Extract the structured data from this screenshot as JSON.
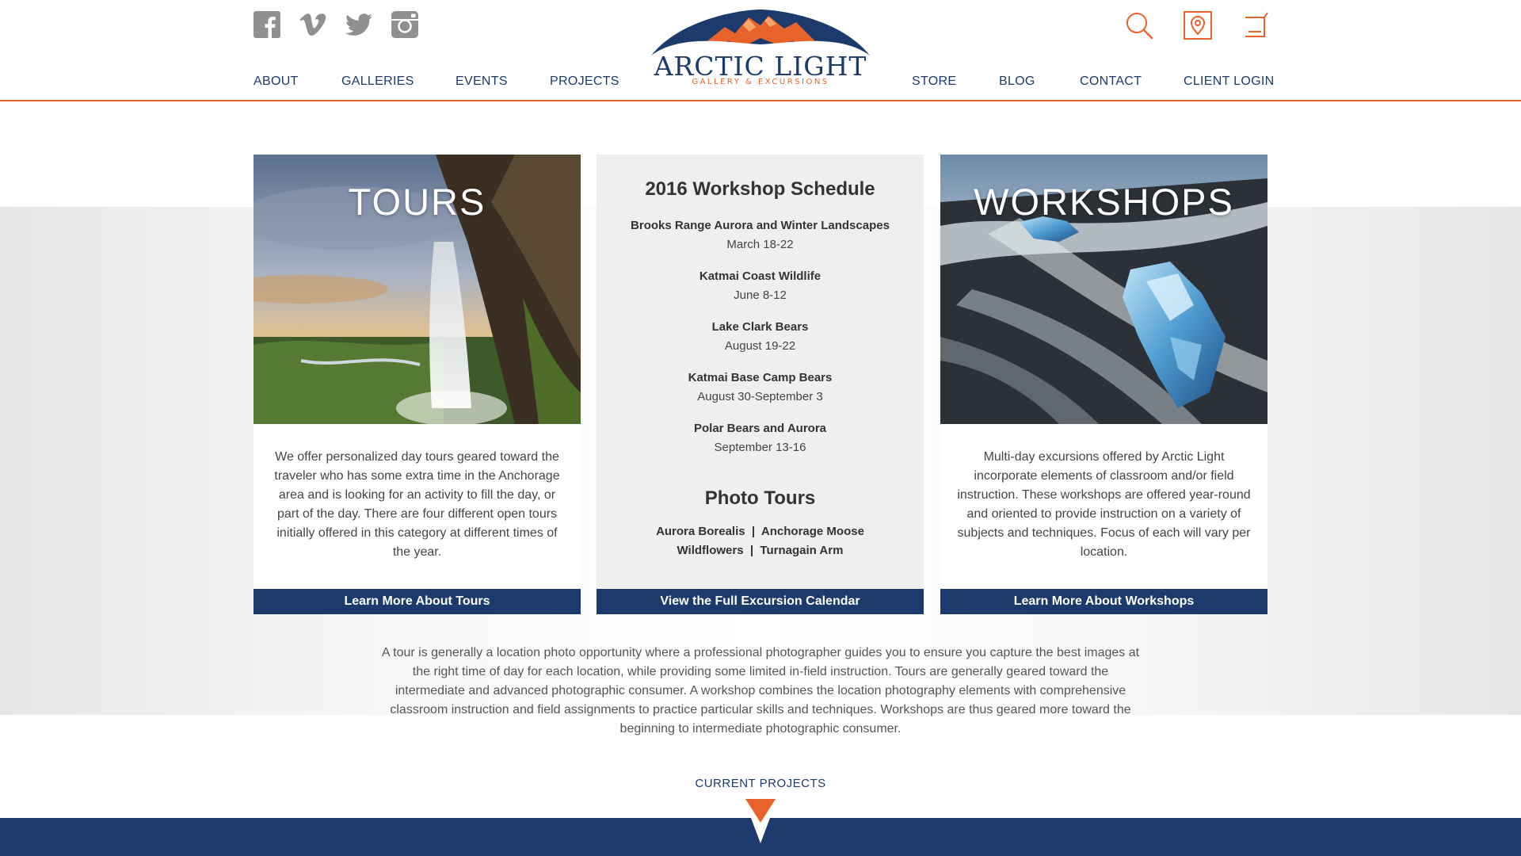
{
  "social": {
    "icons": [
      "facebook-icon",
      "vimeo-icon",
      "twitter-icon",
      "instagram-icon"
    ]
  },
  "tools": {
    "icons": [
      "search-icon",
      "map-pin-icon",
      "cart-icon"
    ]
  },
  "logo": {
    "title": "ARCTIC LIGHT",
    "subtitle": "GALLERY & EXCURSIONS"
  },
  "nav": {
    "left": [
      "ABOUT",
      "GALLERIES",
      "EVENTS",
      "PROJECTS"
    ],
    "right": [
      "STORE",
      "BLOG",
      "CONTACT",
      "CLIENT LOGIN"
    ]
  },
  "tours": {
    "title": "TOURS",
    "description": "We offer personalized day tours geared toward the traveler who has some extra time in the Anchorage area and is looking for an activity to fill the day, or part of the day. There are four different open tours initially offered in this category at different times of the year.",
    "button": "Learn More About Tours"
  },
  "schedule": {
    "title": "2016 Workshop Schedule",
    "items": [
      {
        "name": "Brooks Range Aurora and Winter Landscapes",
        "date": "March 18-22"
      },
      {
        "name": "Katmai Coast Wildlife",
        "date": "June 8-12"
      },
      {
        "name": "Lake Clark Bears",
        "date": "August 19-22"
      },
      {
        "name": "Katmai Base Camp Bears",
        "date": "August 30-September 3"
      },
      {
        "name": "Polar Bears and Aurora",
        "date": "September 13-16"
      }
    ],
    "photo_tours_title": "Photo Tours",
    "photo_tours_line1": "Aurora Borealis  |  Anchorage Moose",
    "photo_tours_line2": "Wildflowers  |  Turnagain Arm",
    "button": "View the Full Excursion Calendar"
  },
  "workshops": {
    "title": "WORKSHOPS",
    "description": "Multi-day excursions offered by Arctic Light incorporate elements of classroom and/or field instruction. These workshops are offered year-round and oriented to provide instruction on a variety of subjects and techniques. Focus of each will vary per location.",
    "button": "Learn More About Workshops"
  },
  "explainer": "A tour is generally a location photo opportunity where a professional photographer guides you to ensure you capture the best images at the right time of day for each location, while providing some limited in-field instruction. Tours are generally geared toward the intermediate and advanced photographic consumer. A workshop combines the location photography elements with comprehensive classroom instruction and field assignments to practice particular skills and techniques. Workshops are thus geared more toward the beginning to intermediate photographic consumer.",
  "current_projects": "CURRENT PROJECTS",
  "colors": {
    "navy": "#1c3a6b",
    "orange": "#e8632b",
    "grey_icon": "#909090"
  }
}
